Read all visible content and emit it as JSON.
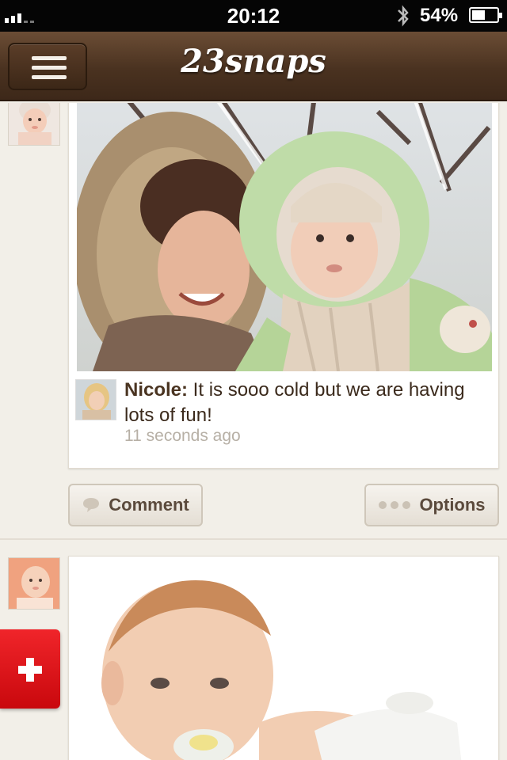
{
  "status_bar": {
    "time": "20:12",
    "battery_percent": "54%",
    "battery_level": 0.54,
    "signal_bars": 3,
    "icons": [
      "signal-icon",
      "bluetooth-icon",
      "battery-icon"
    ]
  },
  "nav": {
    "brand": "23snaps",
    "menu_icon": "hamburger-icon"
  },
  "feed": {
    "posts": [
      {
        "author": "Nicole:",
        "text": " It is sooo cold but we are having lots of fun!",
        "time": "11 seconds ago",
        "actions": {
          "comment": "Comment",
          "options": "Options"
        }
      }
    ]
  },
  "colors": {
    "nav_brown": "#4a3220",
    "accent_red": "#e0171c",
    "background": "#f2efe8"
  }
}
